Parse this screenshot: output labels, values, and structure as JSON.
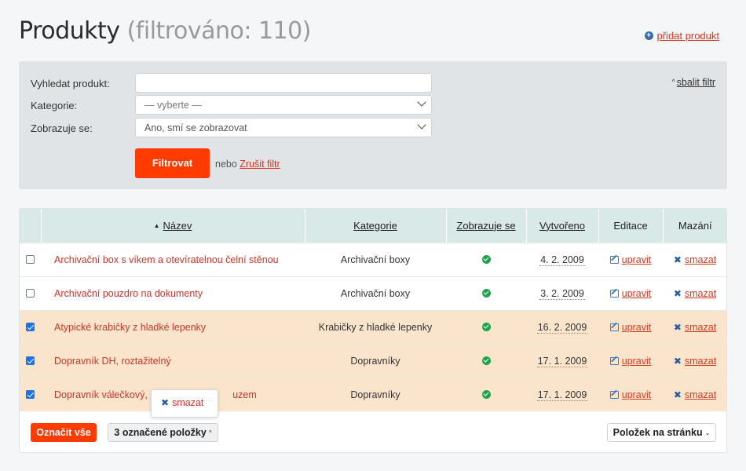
{
  "header": {
    "title": "Produkty",
    "subtitle": "(filtrováno: 110)",
    "add_link": "přidat produkt"
  },
  "filter": {
    "search_label": "Vyhledat produkt:",
    "search_value": "",
    "category_label": "Kategorie:",
    "category_value": "— vyberte —",
    "visible_label": "Zobrazuje se:",
    "visible_value": "Ano, smí se zobrazovat",
    "submit_label": "Filtrovat",
    "or_text": "nebo",
    "clear_label": "Zrušit filtr",
    "collapse_label": "sbalit filtr"
  },
  "table": {
    "columns": {
      "name": "Název",
      "category": "Kategorie",
      "visible": "Zobrazuje se",
      "created": "Vytvořeno",
      "edit": "Editace",
      "delete": "Mazání"
    },
    "rows": [
      {
        "checked": false,
        "name": "Archivační box s víkem a otevíratelnou čelní stěnou",
        "category": "Archivační boxy",
        "created": "4. 2. 2009",
        "edit": "upravit",
        "delete": "smazat"
      },
      {
        "checked": false,
        "name": "Archivační pouzdro na dokumenty",
        "category": "Archivační boxy",
        "created": "3. 2. 2009",
        "edit": "upravit",
        "delete": "smazat"
      },
      {
        "checked": true,
        "name": "Atypické krabičky z hladké lepenky",
        "category": "Krabičky z hladké lepenky",
        "created": "16. 2. 2009",
        "edit": "upravit",
        "delete": "smazat"
      },
      {
        "checked": true,
        "name": "Dopravník DH, roztažitelný",
        "category": "Dopravníky",
        "created": "17. 1. 2009",
        "edit": "upravit",
        "delete": "smazat"
      },
      {
        "checked": true,
        "name": "Dopravník válečkový, n",
        "name_tail": "uzem",
        "category": "Dopravníky",
        "created": "17. 1. 2009",
        "edit": "upravit",
        "delete": "smazat"
      }
    ]
  },
  "popup": {
    "label": "smazat"
  },
  "footer": {
    "select_all": "Označit vše",
    "selected_items": "3 označené položky",
    "per_page": "Položek na stránku"
  },
  "colors": {
    "accent": "#ff3b00",
    "link": "#d9381e",
    "selected_row": "#fae5cc",
    "header_row": "#d8e9e8"
  }
}
